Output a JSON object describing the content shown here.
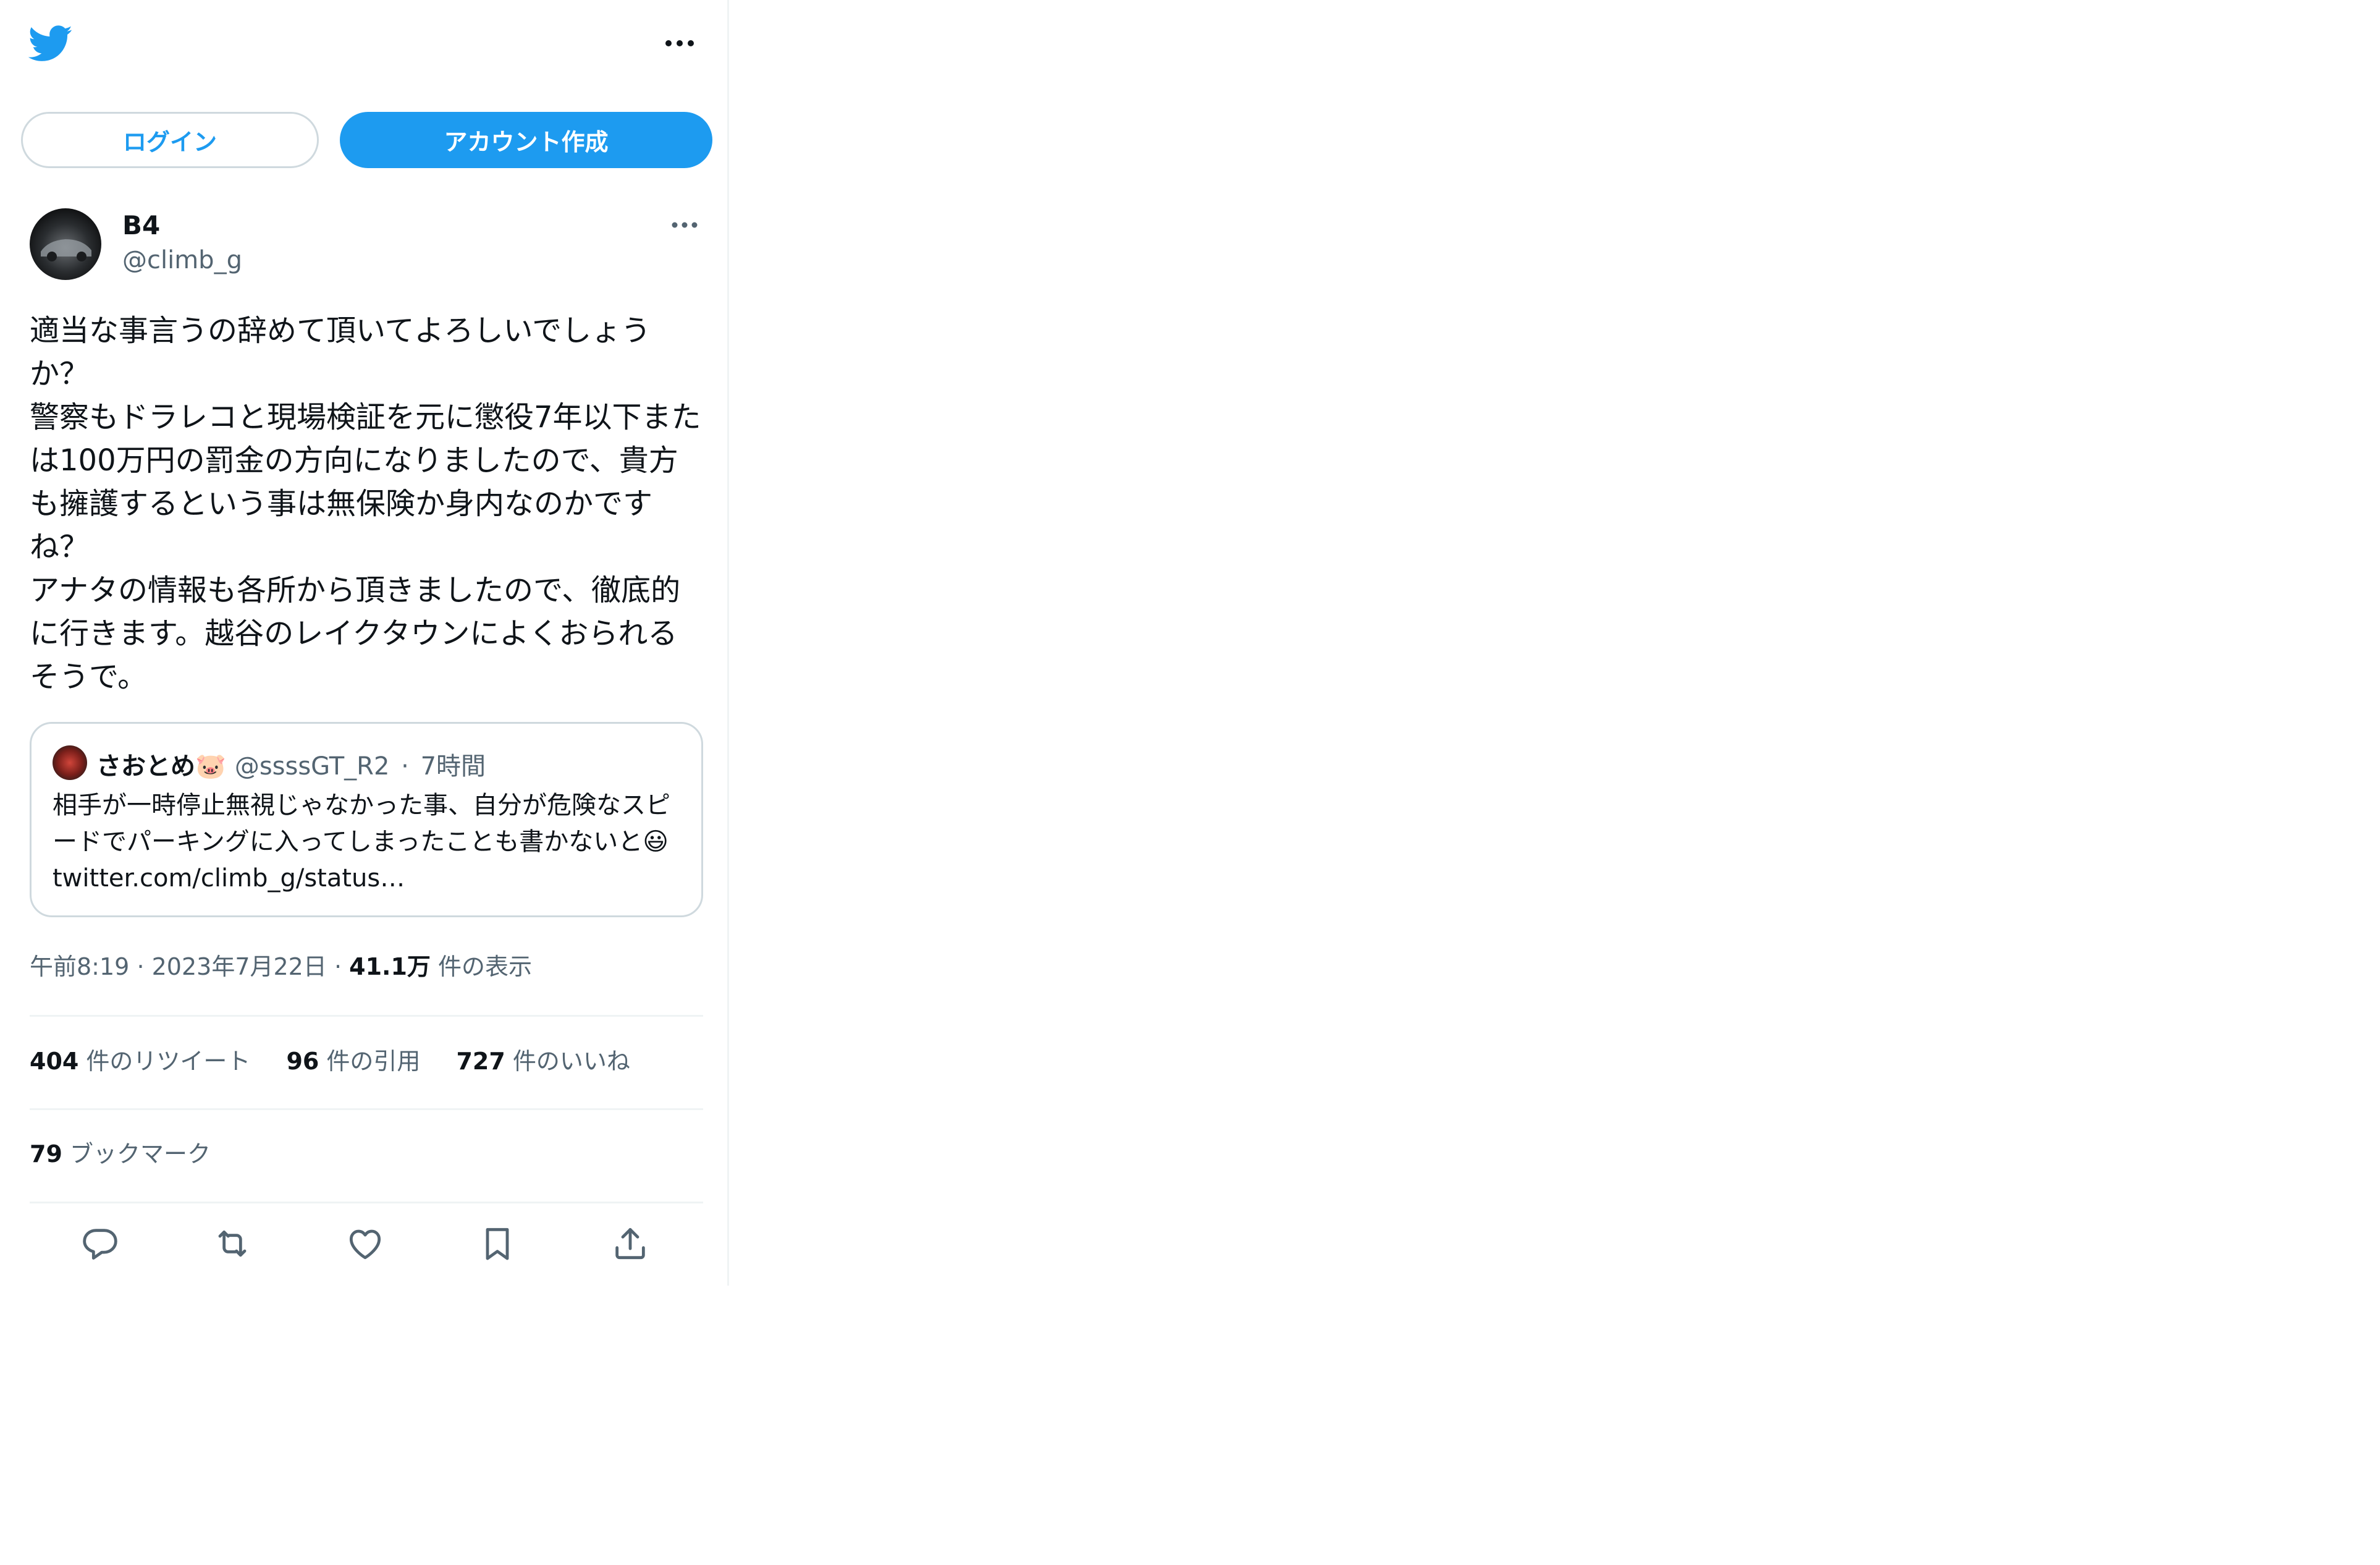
{
  "header": {
    "logo_icon": "twitter-bird-icon",
    "more_icon": "more-horizontal-icon"
  },
  "auth": {
    "login_label": "ログイン",
    "signup_label": "アカウント作成"
  },
  "tweet": {
    "author": {
      "name": "B4",
      "handle": "@climb_g"
    },
    "text": "適当な事言うの辞めて頂いてよろしいでしょうか？\n警察もドラレコと現場検証を元に懲役7年以下または100万円の罰金の方向になりましたので、貴方も擁護するという事は無保険か身内なのかですね？\nアナタの情報も各所から頂きましたので、徹底的に行きます。越谷のレイクタウンによくおられるそうで。",
    "quote": {
      "name": "さおとめ",
      "emoji": "🐷",
      "handle": "@ssssGT_R2",
      "separator": "·",
      "time": "7時間",
      "text": "相手が一時停止無視じゃなかった事、自分が危険なスピードでパーキングに入ってしまったことも書かないと",
      "text_emoji": "😃",
      "link": "twitter.com/climb_g/status…"
    },
    "meta": {
      "time": "午前8:19",
      "sep1": "·",
      "date": "2023年7月22日",
      "sep2": "·",
      "views_count": "41.1万",
      "views_label": "件の表示"
    },
    "stats": {
      "retweets": "404",
      "retweets_label": "件のリツイート",
      "quotes": "96",
      "quotes_label": "件の引用",
      "likes": "727",
      "likes_label": "件のいいね",
      "bookmarks": "79",
      "bookmarks_label": "ブックマーク"
    }
  },
  "actions": [
    "reply-icon",
    "retweet-icon",
    "like-icon",
    "bookmark-icon",
    "share-icon"
  ],
  "colors": {
    "accent": "#1d9bf0",
    "text": "#0f1419",
    "muted": "#536471",
    "border": "#cfd9de"
  }
}
